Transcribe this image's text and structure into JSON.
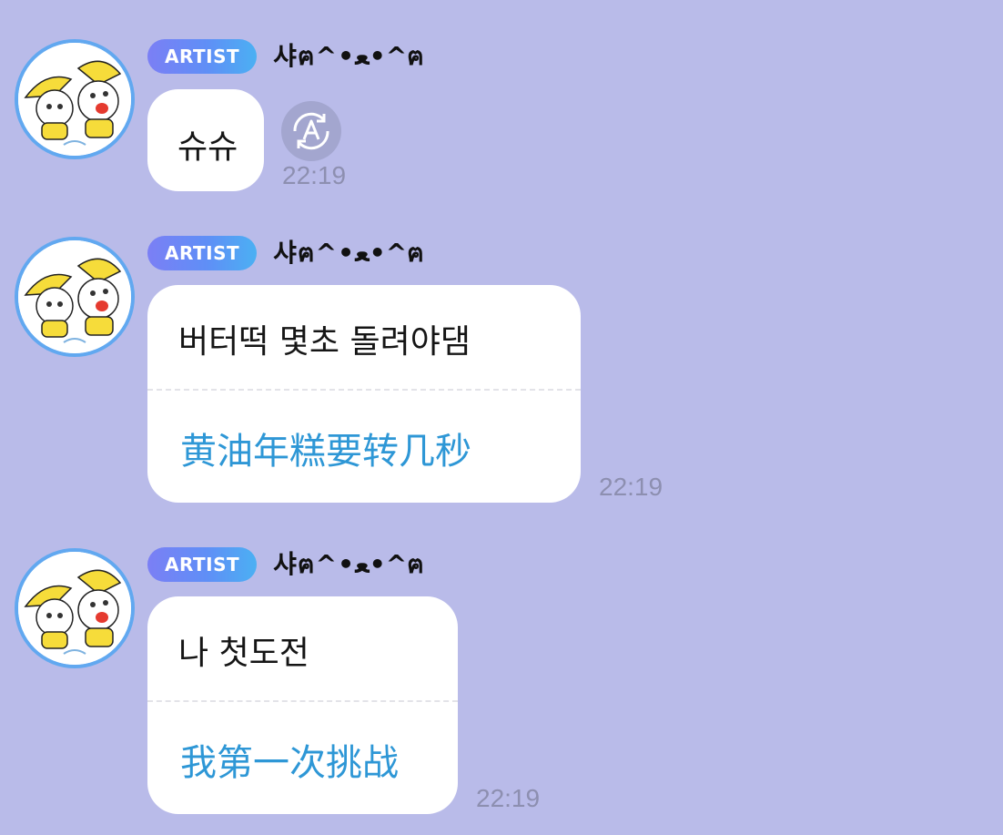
{
  "colors": {
    "background": "#b9bbe9",
    "badge_gradient_start": "#7b7ff5",
    "badge_gradient_end": "#4bb0f3",
    "translation_text": "#2e97d6",
    "timestamp": "#8d8fb0",
    "avatar_ring": "#61a8f0"
  },
  "messages": [
    {
      "badge": "ARTIST",
      "username": "샤ฅ^•ﻌ•^ฅ",
      "avatar_icon": "cartoon-cats-umbrella-avatar",
      "text": "슈슈",
      "translation": "",
      "time": "22:19",
      "translate_icon": "auto-translate-icon"
    },
    {
      "badge": "ARTIST",
      "username": "샤ฅ^•ﻌ•^ฅ",
      "avatar_icon": "cartoon-cats-umbrella-avatar",
      "text": "버터떡 몇초 돌려야댐",
      "translation": "黄油年糕要转几秒",
      "time": "22:19"
    },
    {
      "badge": "ARTIST",
      "username": "샤ฅ^•ﻌ•^ฅ",
      "avatar_icon": "cartoon-cats-umbrella-avatar",
      "text": "나 첫도전",
      "translation": "我第一次挑战",
      "time": "22:19"
    }
  ]
}
